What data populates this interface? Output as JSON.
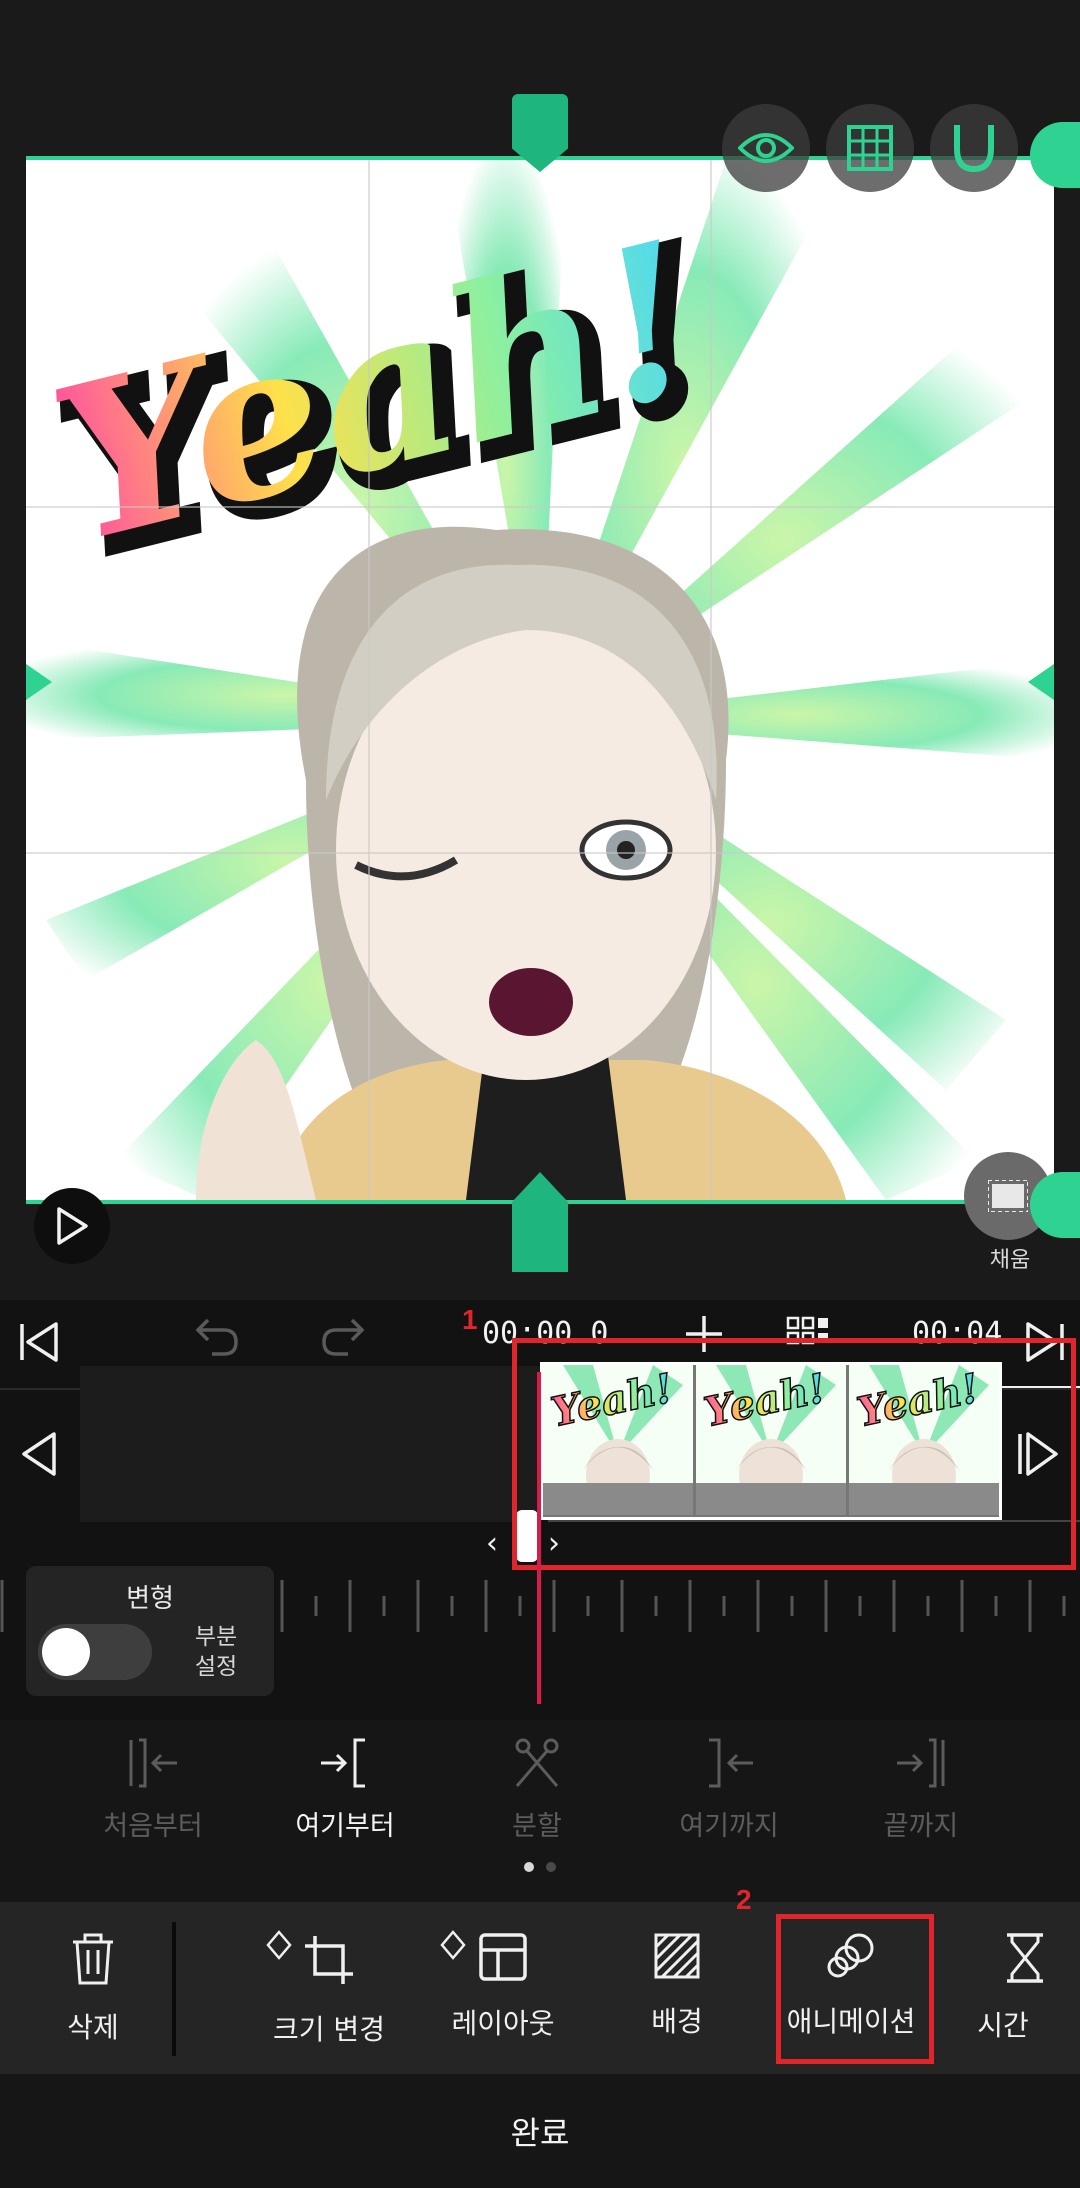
{
  "preview": {
    "fill_label": "채움",
    "sticker_text": "Yeah!"
  },
  "timeline": {
    "current_time": "00:00.0",
    "end_time": "00:04",
    "annotation_1": "1",
    "annotation_2": "2"
  },
  "transform": {
    "title": "변형",
    "toggle_label": "부분\n설정",
    "toggle_on": false
  },
  "edit_tools": [
    {
      "label": "처음부터",
      "enabled": false
    },
    {
      "label": "여기부터",
      "enabled": true
    },
    {
      "label": "분할",
      "enabled": false
    },
    {
      "label": "여기까지",
      "enabled": false
    },
    {
      "label": "끝까지",
      "enabled": false
    }
  ],
  "menu": [
    {
      "label": "삭제",
      "icon": "trash-icon"
    },
    {
      "label": "크기 변경",
      "icon": "crop-icon"
    },
    {
      "label": "레이아웃",
      "icon": "layout-icon"
    },
    {
      "label": "배경",
      "icon": "background-icon"
    },
    {
      "label": "애니메이션",
      "icon": "animation-icon"
    },
    {
      "label": "시간",
      "icon": "hourglass-icon"
    }
  ],
  "done_label": "완료",
  "colors": {
    "accent": "#2ed391",
    "highlight": "#e0252c",
    "playhead": "#d81b4a"
  }
}
